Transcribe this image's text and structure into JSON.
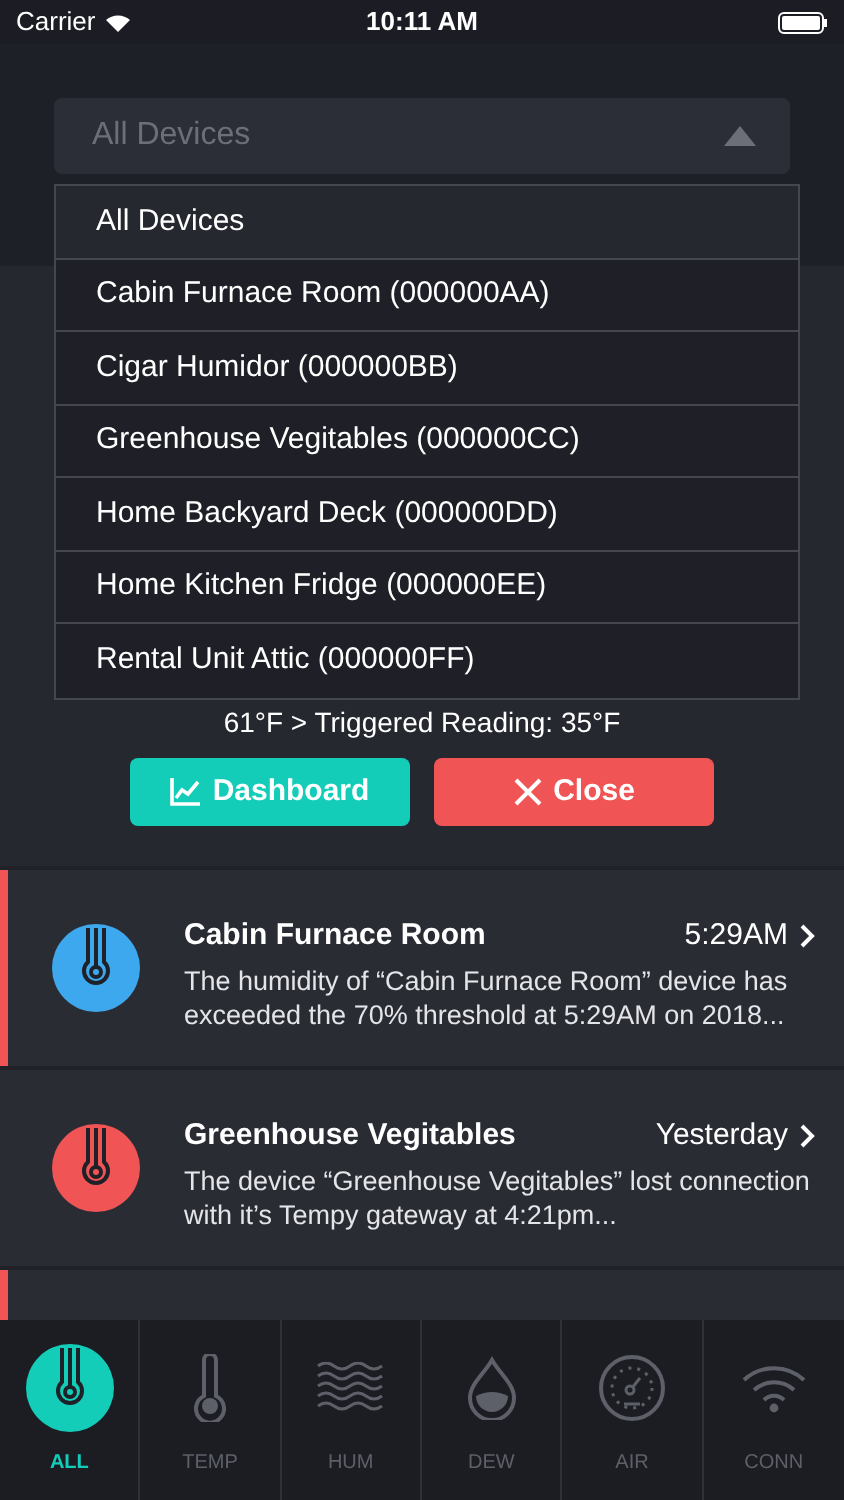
{
  "status_bar": {
    "carrier": "Carrier",
    "time": "10:11 AM"
  },
  "device_select": {
    "value": "All Devices",
    "expanded": true,
    "options": [
      {
        "label": "All Devices",
        "selected": true
      },
      {
        "label": "Cabin Furnace Room (000000AA)",
        "selected": false
      },
      {
        "label": "Cigar Humidor (000000BB)",
        "selected": false
      },
      {
        "label": "Greenhouse Vegitables (000000CC)",
        "selected": false
      },
      {
        "label": "Home Backyard Deck (000000DD)",
        "selected": false
      },
      {
        "label": "Home Kitchen Fridge (000000EE)",
        "selected": false
      },
      {
        "label": "Rental Unit Attic (000000FF)",
        "selected": false
      }
    ]
  },
  "alert_detail": {
    "reading": "61°F > Triggered Reading: 35°F",
    "buttons": [
      {
        "label": "Dashboard",
        "kind": "dashboard"
      },
      {
        "label": "Close",
        "kind": "close"
      }
    ]
  },
  "alerts": [
    {
      "title": "Cabin Furnace Room",
      "time": "5:29AM",
      "message": "The humidity of “Cabin Furnace Room” device has exceeded the 70% threshold at 5:29AM on 2018...",
      "unread": true,
      "color": "#3ea8ef"
    },
    {
      "title": "Greenhouse Vegitables",
      "time": "Yesterday",
      "message": "The device “Greenhouse Vegitables” lost connection with it’s Tempy gateway at 4:21pm...",
      "unread": false,
      "color": "#f05454"
    },
    {
      "unread": true
    }
  ],
  "tabs": [
    {
      "label": "ALL",
      "kind": "all",
      "selected": true
    },
    {
      "label": "TEMP",
      "kind": "temp",
      "selected": false
    },
    {
      "label": "HUM",
      "kind": "hum",
      "selected": false
    },
    {
      "label": "DEW",
      "kind": "dew",
      "selected": false
    },
    {
      "label": "AIR",
      "kind": "air",
      "selected": false
    },
    {
      "label": "CONN",
      "kind": "conn",
      "selected": false
    }
  ]
}
